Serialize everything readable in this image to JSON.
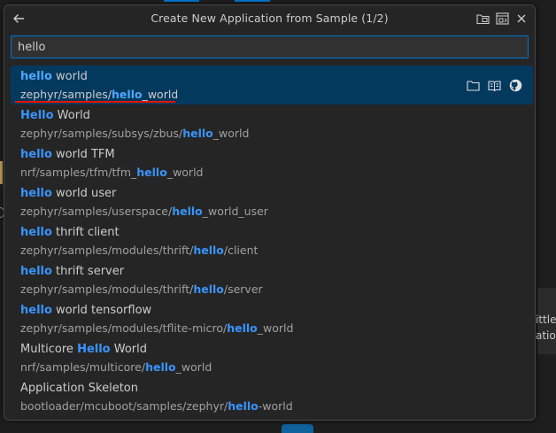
{
  "window": {
    "title": "Create New Application from Sample (1/2)",
    "bg_fragments": [
      "ittle",
      "atio"
    ]
  },
  "search": {
    "value": "hello"
  },
  "items": [
    {
      "pre": "",
      "match": "hello",
      "post": " world",
      "desc_pre": "zephyr/samples/",
      "desc_match": "hello",
      "desc_post": "_world",
      "selected": true
    },
    {
      "pre": "",
      "match": "Hello",
      "post": " World",
      "desc_pre": "zephyr/samples/subsys/zbus/",
      "desc_match": "hello",
      "desc_post": "_world"
    },
    {
      "pre": "",
      "match": "hello",
      "post": " world TFM",
      "desc_pre": "nrf/samples/tfm/tfm_",
      "desc_match": "hello",
      "desc_post": "_world"
    },
    {
      "pre": "",
      "match": "hello",
      "post": " world user",
      "desc_pre": "zephyr/samples/userspace/",
      "desc_match": "hello",
      "desc_post": "_world_user"
    },
    {
      "pre": "",
      "match": "hello",
      "post": " thrift client",
      "desc_pre": "zephyr/samples/modules/thrift/",
      "desc_match": "hello",
      "desc_post": "/client"
    },
    {
      "pre": "",
      "match": "hello",
      "post": " thrift server",
      "desc_pre": "zephyr/samples/modules/thrift/",
      "desc_match": "hello",
      "desc_post": "/server"
    },
    {
      "pre": "",
      "match": "hello",
      "post": " world tensorflow",
      "desc_pre": "zephyr/samples/modules/tflite-micro/",
      "desc_match": "hello",
      "desc_post": "_world"
    },
    {
      "pre": "Multicore ",
      "match": "Hello",
      "post": " World",
      "desc_pre": "nrf/samples/multicore/",
      "desc_match": "hello",
      "desc_post": "_world"
    },
    {
      "pre": "Application Skeleton",
      "match": "",
      "post": "",
      "desc_pre": "bootloader/mcuboot/samples/zephyr/",
      "desc_match": "hello",
      "desc_post": "-world"
    }
  ],
  "icons": {
    "back": "arrow-left-icon",
    "header": [
      "open-folder-icon",
      "open-workspace-icon",
      "close-icon"
    ],
    "item": [
      "folder-icon",
      "book-icon",
      "github-icon"
    ]
  },
  "colors": {
    "accent": "#0078d4",
    "selection": "#04395e",
    "highlight": "#3794ff",
    "underline": "#e51400"
  }
}
